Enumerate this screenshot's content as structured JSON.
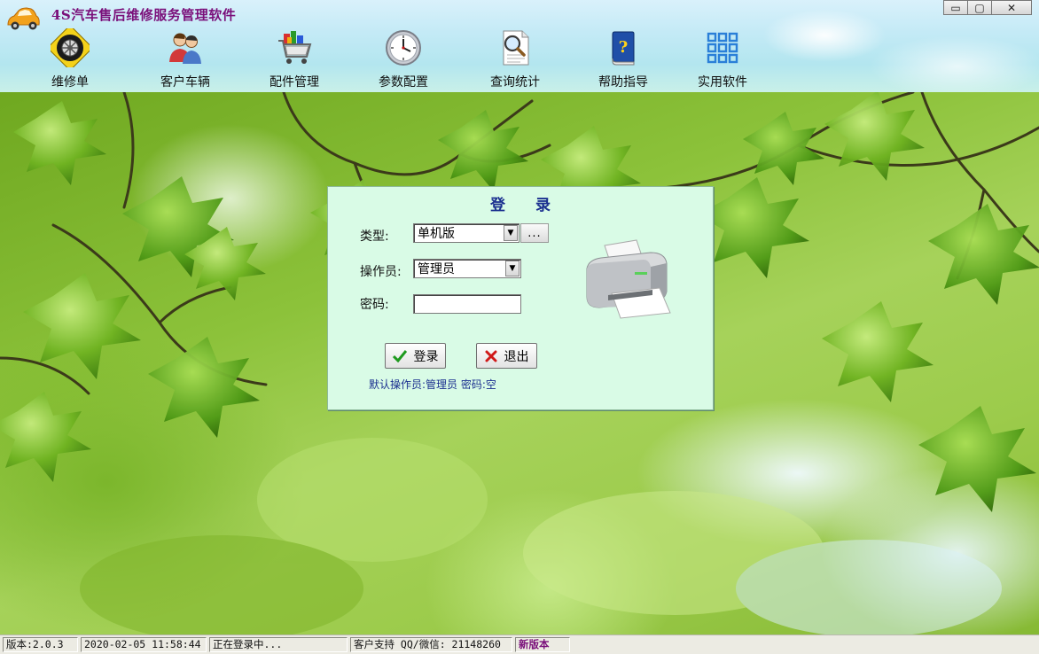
{
  "app": {
    "title": "4S汽车售后维修服务管理软件",
    "window_controls": {
      "minimize": "▭",
      "restore": "▢",
      "close": "✕"
    }
  },
  "toolbar": [
    {
      "label": "维修单",
      "icon": "tire-icon"
    },
    {
      "label": "客户车辆",
      "icon": "customers-icon"
    },
    {
      "label": "配件管理",
      "icon": "parts-cart-icon"
    },
    {
      "label": "参数配置",
      "icon": "clock-icon"
    },
    {
      "label": "查询统计",
      "icon": "magnifier-document-icon"
    },
    {
      "label": "帮助指导",
      "icon": "help-book-icon"
    },
    {
      "label": "实用软件",
      "icon": "app-grid-icon"
    }
  ],
  "login": {
    "title": "登 录",
    "type_label": "类型:",
    "type_value": "单机版",
    "more_button": "...",
    "operator_label": "操作员:",
    "operator_value": "管理员",
    "password_label": "密码:",
    "password_value": "",
    "login_button": "登录",
    "exit_button": "退出",
    "hint": "默认操作员:管理员 密码:空"
  },
  "status": {
    "version": "版本:2.0.3",
    "datetime": "2020-02-05 11:58:44",
    "state": "正在登录中...",
    "support": "客户支持 QQ/微信: 21148260",
    "new_version": "新版本"
  },
  "colors": {
    "title": "#7a0f7a",
    "login_panel": "#d9fbe6",
    "login_title": "#1a2f8f",
    "ok_check": "#1f9a1f",
    "cancel_x": "#d01818"
  }
}
